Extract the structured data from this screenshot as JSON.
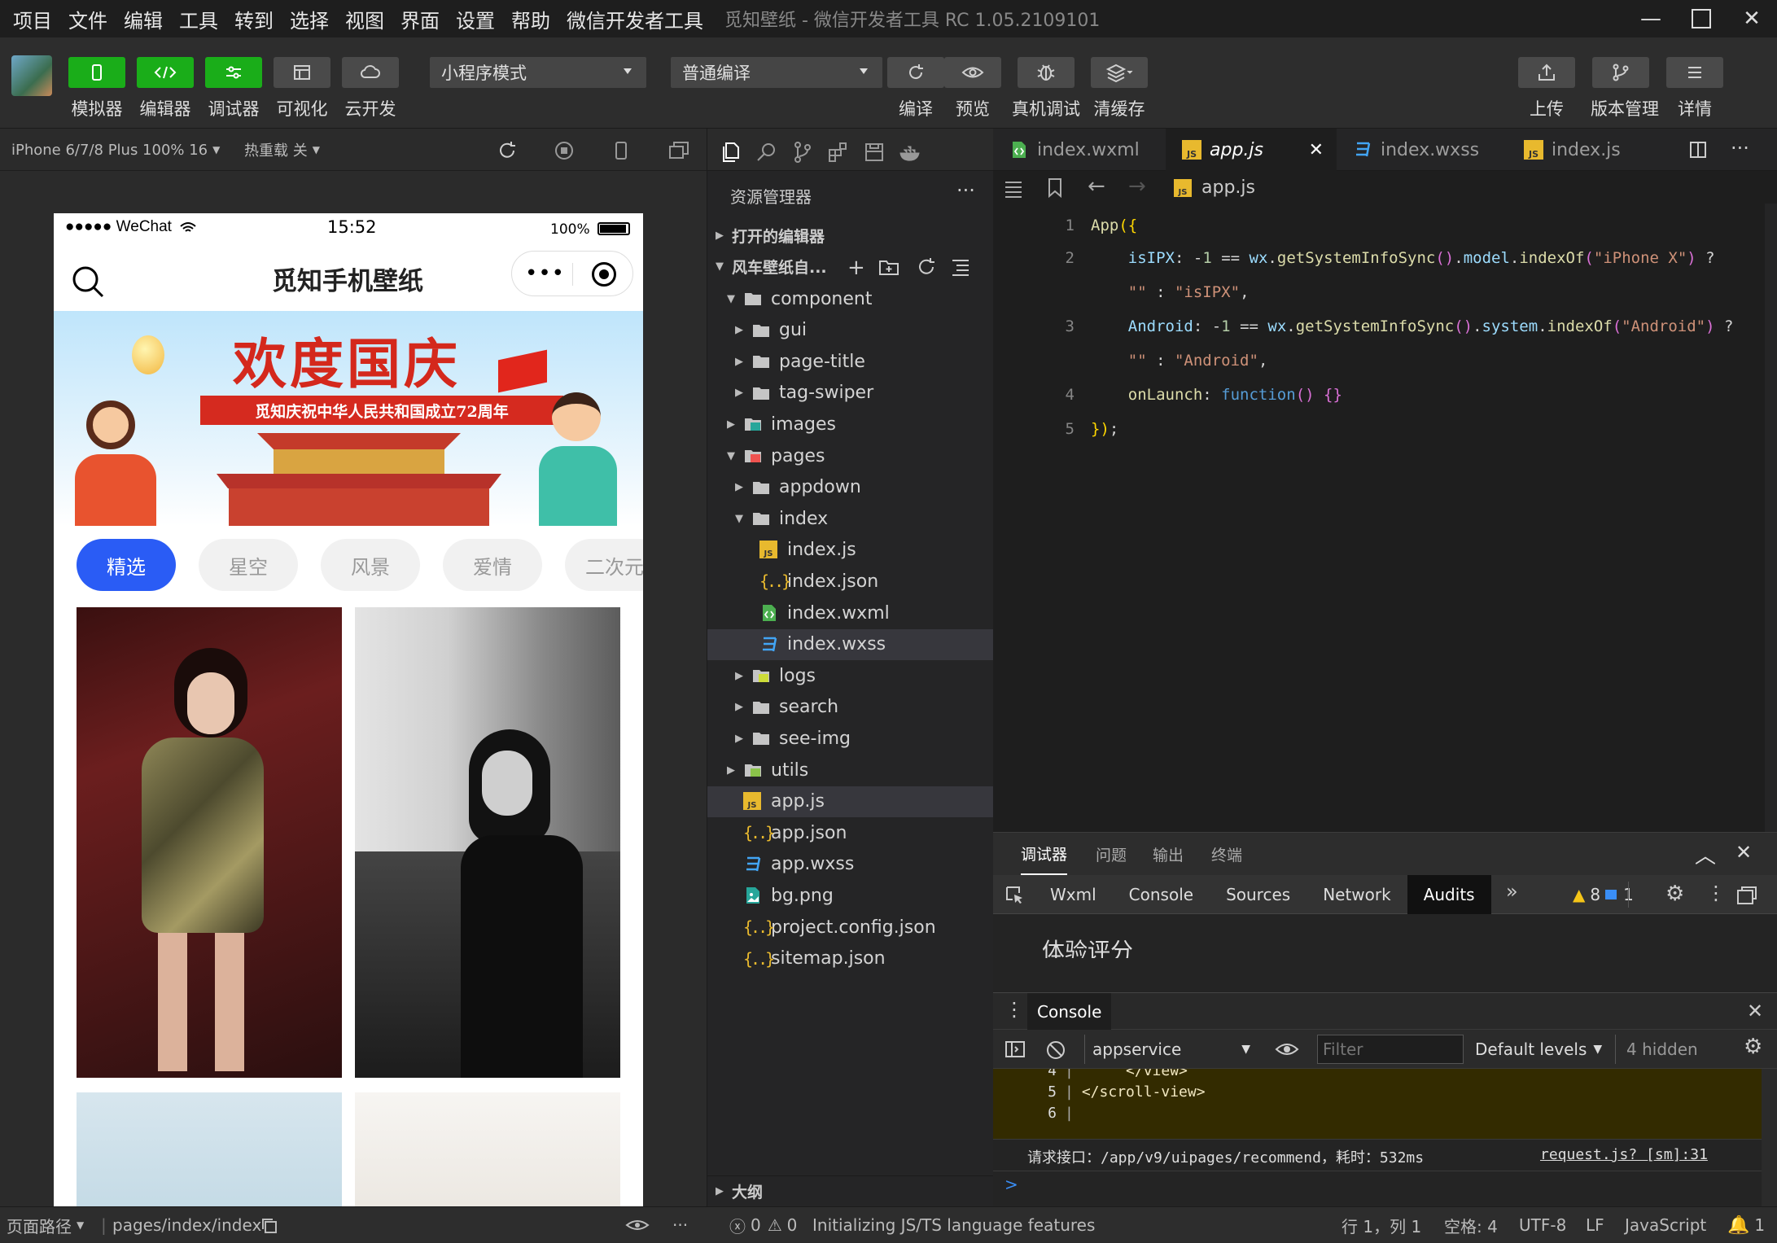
{
  "menu": [
    "项目",
    "文件",
    "编辑",
    "工具",
    "转到",
    "选择",
    "视图",
    "界面",
    "设置",
    "帮助",
    "微信开发者工具"
  ],
  "window_title": "觅知壁纸 - 微信开发者工具 RC 1.05.2109101",
  "toolbar": {
    "simulator": "模拟器",
    "editor": "编辑器",
    "debugger": "调试器",
    "visual": "可视化",
    "cloud": "云开发",
    "mode_select": "小程序模式",
    "compile_select": "普通编译",
    "compile": "编译",
    "preview": "预览",
    "remote_debug": "真机调试",
    "clear_cache": "清缓存",
    "upload": "上传",
    "version": "版本管理",
    "details": "详情"
  },
  "sim_header": {
    "device": "iPhone 6/7/8 Plus 100% 16",
    "hot_reload": "热重载 关"
  },
  "phone": {
    "status_carrier": "●●●●● WeChat",
    "status_time": "15:52",
    "status_battery": "100%",
    "title": "觅知手机壁纸",
    "banner_title": "欢度国庆",
    "banner_ribbon": "觅知庆祝中华人民共和国成立72周年",
    "categories": [
      "精选",
      "星空",
      "风景",
      "爱情",
      "二次元"
    ]
  },
  "explorer": {
    "title": "资源管理器",
    "open_editors": "打开的编辑器",
    "project": "风车壁纸自...",
    "outline": "大纲",
    "tree": [
      {
        "label": "component",
        "depth": 1,
        "type": "folder",
        "open": true
      },
      {
        "label": "gui",
        "depth": 2,
        "type": "folder"
      },
      {
        "label": "page-title",
        "depth": 2,
        "type": "folder"
      },
      {
        "label": "tag-swiper",
        "depth": 2,
        "type": "folder"
      },
      {
        "label": "images",
        "depth": 1,
        "type": "folder-img"
      },
      {
        "label": "pages",
        "depth": 1,
        "type": "folder-red",
        "open": true
      },
      {
        "label": "appdown",
        "depth": 2,
        "type": "folder"
      },
      {
        "label": "index",
        "depth": 2,
        "type": "folder",
        "open": true
      },
      {
        "label": "index.js",
        "depth": 3,
        "type": "js"
      },
      {
        "label": "index.json",
        "depth": 3,
        "type": "json"
      },
      {
        "label": "index.wxml",
        "depth": 3,
        "type": "wxml"
      },
      {
        "label": "index.wxss",
        "depth": 3,
        "type": "wxss",
        "selected": true
      },
      {
        "label": "logs",
        "depth": 2,
        "type": "folder-y"
      },
      {
        "label": "search",
        "depth": 2,
        "type": "folder"
      },
      {
        "label": "see-img",
        "depth": 2,
        "type": "folder"
      },
      {
        "label": "utils",
        "depth": 1,
        "type": "folder-g"
      },
      {
        "label": "app.js",
        "depth": 1,
        "type": "js",
        "selected": true
      },
      {
        "label": "app.json",
        "depth": 1,
        "type": "json"
      },
      {
        "label": "app.wxss",
        "depth": 1,
        "type": "wxss"
      },
      {
        "label": "bg.png",
        "depth": 1,
        "type": "png"
      },
      {
        "label": "project.config.json",
        "depth": 1,
        "type": "json"
      },
      {
        "label": "sitemap.json",
        "depth": 1,
        "type": "json"
      }
    ]
  },
  "tabs": [
    "index.wxml",
    "app.js",
    "index.wxss",
    "index.js"
  ],
  "breadcrumb_file": "app.js",
  "code": [
    {
      "n": "1",
      "html": "<span style='color:#dcdcaa'>App</span><span style='color:#ffd700'>({</span>"
    },
    {
      "n": "2",
      "html": "    <span style='color:#9cdcfe'>isIPX</span>: <span style='color:#d4d4d4'>-</span><span style='color:#b5cea8'>1</span> == <span style='color:#9cdcfe'>wx</span>.<span style='color:#dcdcaa'>getSystemInfoSync</span><span style='color:#da70d6'>()</span>.<span style='color:#9cdcfe'>model</span>.<span style='color:#dcdcaa'>indexOf</span><span style='color:#da70d6'>(</span><span style='color:#ce9178'>\"iPhone X\"</span><span style='color:#da70d6'>)</span> ?"
    },
    {
      "n": "",
      "html": "    <span style='color:#ce9178'>\"\"</span> : <span style='color:#ce9178'>\"isIPX\"</span>,"
    },
    {
      "n": "3",
      "html": "    <span style='color:#9cdcfe'>Android</span>: -<span style='color:#b5cea8'>1</span> == <span style='color:#9cdcfe'>wx</span>.<span style='color:#dcdcaa'>getSystemInfoSync</span><span style='color:#da70d6'>()</span>.<span style='color:#9cdcfe'>system</span>.<span style='color:#dcdcaa'>indexOf</span><span style='color:#da70d6'>(</span><span style='color:#ce9178'>\"Android\"</span><span style='color:#da70d6'>)</span> ?"
    },
    {
      "n": "",
      "html": "    <span style='color:#ce9178'>\"\"</span> : <span style='color:#ce9178'>\"Android\"</span>,"
    },
    {
      "n": "4",
      "html": "    <span style='color:#dcdcaa'>onLaunch</span>: <span style='color:#569cd6'>function</span><span style='color:#da70d6'>()</span> <span style='color:#da70d6'>{}</span>"
    },
    {
      "n": "5",
      "html": "<span style='color:#ffd700'>})</span>;"
    }
  ],
  "devtools": {
    "top_tabs": [
      "调试器",
      "问题",
      "输出",
      "终端"
    ],
    "panels": [
      "Wxml",
      "Console",
      "Sources",
      "Network",
      "Audits"
    ],
    "warn_count": "8",
    "info_count": "1",
    "audit_heading": "体验评分",
    "console_tab": "Console",
    "context": "appservice",
    "filter_placeholder": "Filter",
    "levels": "Default levels",
    "hidden": "4 hidden",
    "console_lines": [
      {
        "n": "4",
        "t": "     </view>"
      },
      {
        "n": "5",
        "t": "</scroll-view>"
      },
      {
        "n": "6",
        "t": ""
      }
    ],
    "request_log": "请求接口：/app/v9/uipages/recommend，耗时：532ms",
    "request_src": "request.js? [sm]:31",
    "prompt": ">"
  },
  "status": {
    "page_path_label": "页面路径",
    "page_path": "pages/index/index",
    "errors": "0",
    "warnings": "0",
    "message": "Initializing JS/TS language features",
    "position": "行 1，列 1",
    "spaces": "空格: 4",
    "encoding": "UTF-8",
    "eol": "LF",
    "language": "JavaScript",
    "notifications": "1"
  },
  "colors": {
    "accent_green": "#1aad19",
    "tab_blue": "#2a5cf5",
    "console_warn_bg": "#332b00"
  }
}
